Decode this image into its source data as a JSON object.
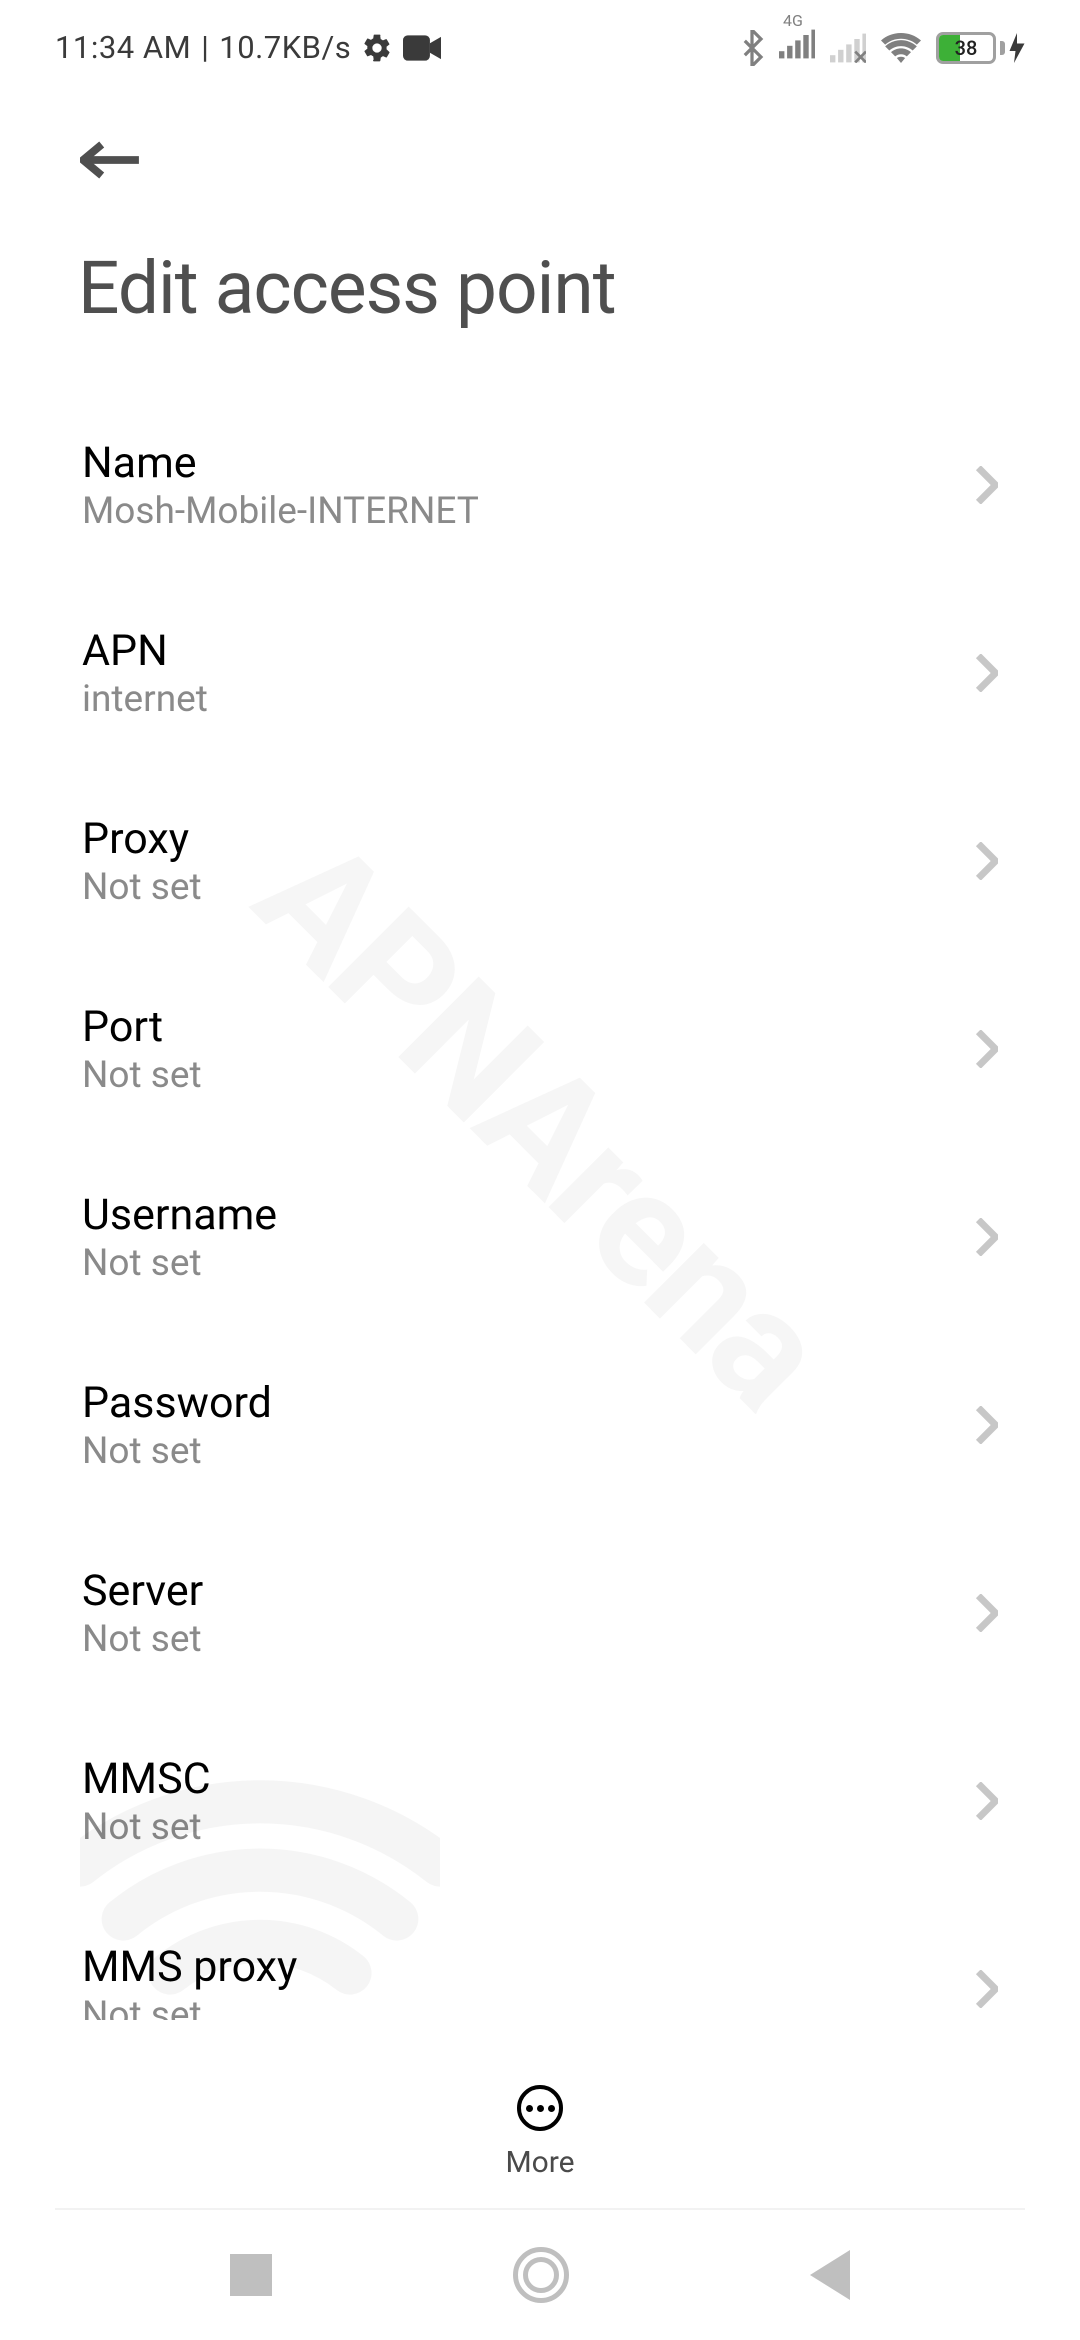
{
  "statusBar": {
    "time": "11:34 AM",
    "speed": "10.7KB/s",
    "battery": "38",
    "networkLabel": "4G"
  },
  "header": {
    "title": "Edit access point"
  },
  "items": [
    {
      "label": "Name",
      "value": "Mosh-Mobile-INTERNET"
    },
    {
      "label": "APN",
      "value": "internet"
    },
    {
      "label": "Proxy",
      "value": "Not set"
    },
    {
      "label": "Port",
      "value": "Not set"
    },
    {
      "label": "Username",
      "value": "Not set"
    },
    {
      "label": "Password",
      "value": "Not set"
    },
    {
      "label": "Server",
      "value": "Not set"
    },
    {
      "label": "MMSC",
      "value": "Not set"
    },
    {
      "label": "MMS proxy",
      "value": "Not set"
    }
  ],
  "bottom": {
    "moreLabel": "More"
  },
  "watermark": "APNArena"
}
